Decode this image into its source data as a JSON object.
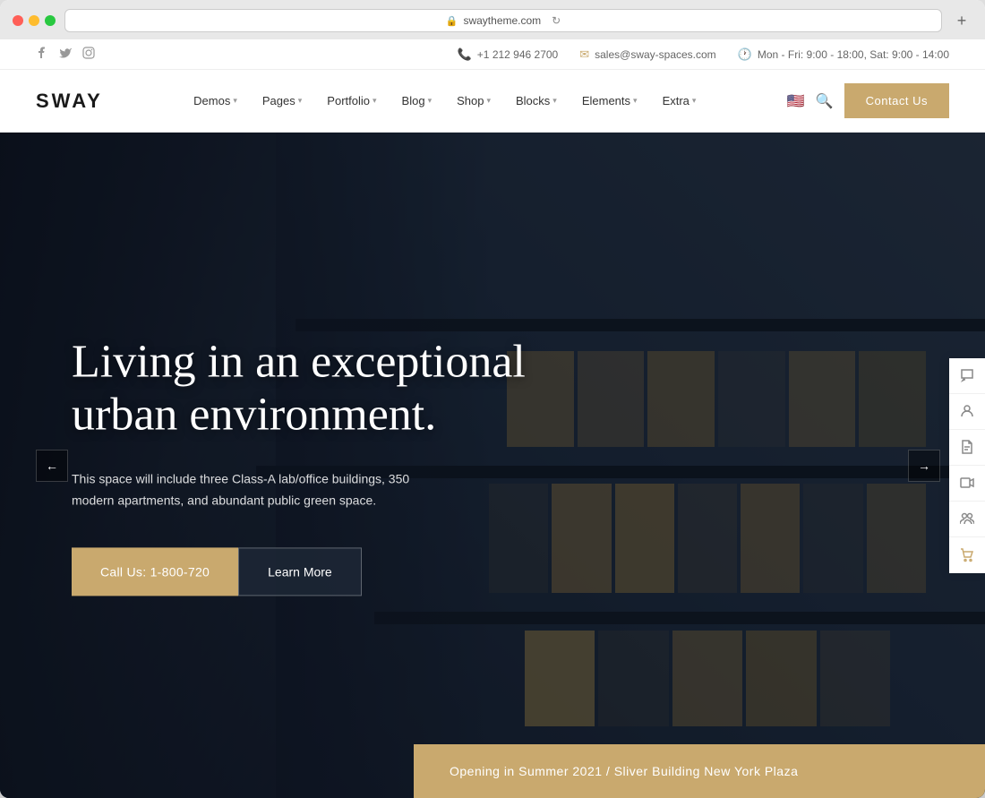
{
  "browser": {
    "url": "swaytheme.com",
    "new_tab_label": "+"
  },
  "top_bar": {
    "phone": "+1 212 946 2700",
    "email": "sales@sway-spaces.com",
    "hours": "Mon - Fri: 9:00 - 18:00, Sat: 9:00 - 14:00",
    "social": {
      "facebook": "f",
      "twitter": "t",
      "instagram": "ig"
    }
  },
  "nav": {
    "brand": "SWAY",
    "items": [
      {
        "label": "Demos",
        "has_dropdown": true
      },
      {
        "label": "Pages",
        "has_dropdown": true
      },
      {
        "label": "Portfolio",
        "has_dropdown": true
      },
      {
        "label": "Blog",
        "has_dropdown": true
      },
      {
        "label": "Shop",
        "has_dropdown": true
      },
      {
        "label": "Blocks",
        "has_dropdown": true
      },
      {
        "label": "Elements",
        "has_dropdown": true
      },
      {
        "label": "Extra",
        "has_dropdown": true
      }
    ],
    "contact_button": "Contact Us"
  },
  "hero": {
    "title": "Living in an exceptional urban environment.",
    "subtitle": "This space will include three Class-A lab/office buildings, 350 modern apartments, and abundant public green space.",
    "btn_call": "Call Us: 1-800-720",
    "btn_learn": "Learn More",
    "arrow_left": "←",
    "arrow_right": "→",
    "bottom_text": "Opening in Summer 2021 / Sliver Building New York Plaza"
  },
  "sidebar": {
    "icons": [
      {
        "name": "chat-icon",
        "symbol": "💬"
      },
      {
        "name": "user-circle-icon",
        "symbol": "👤"
      },
      {
        "name": "document-icon",
        "symbol": "📄"
      },
      {
        "name": "video-icon",
        "symbol": "🎥"
      },
      {
        "name": "team-icon",
        "symbol": "👥"
      },
      {
        "name": "cart-icon",
        "symbol": "🛒"
      }
    ]
  },
  "colors": {
    "brand_gold": "#c9a96e",
    "dark_bg": "#1a2535",
    "text_light": "#ffffff"
  }
}
